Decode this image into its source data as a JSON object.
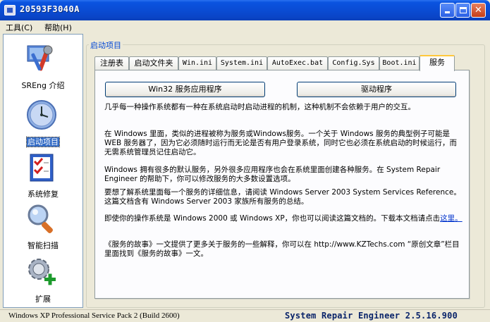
{
  "window": {
    "title": "20593F3040A"
  },
  "menubar": {
    "items": [
      {
        "label": "工具(C)"
      },
      {
        "label": "帮助(H)"
      }
    ]
  },
  "sidebar": {
    "items": [
      {
        "label": "SREng 介绍",
        "icon": "tools-icon",
        "selected": false
      },
      {
        "label": "启动项目",
        "icon": "clock-icon",
        "selected": true
      },
      {
        "label": "系统修复",
        "icon": "checklist-icon",
        "selected": false
      },
      {
        "label": "智能扫描",
        "icon": "magnifier-icon",
        "selected": false
      },
      {
        "label": "扩展",
        "icon": "gear-plus-icon",
        "selected": false
      }
    ]
  },
  "group": {
    "title": "启动项目"
  },
  "tabs": [
    {
      "label": "注册表"
    },
    {
      "label": "启动文件夹"
    },
    {
      "label": "Win.ini"
    },
    {
      "label": "System.ini"
    },
    {
      "label": "AutoExec.bat"
    },
    {
      "label": "Config.Sys"
    },
    {
      "label": "Boot.ini"
    },
    {
      "label": "服务",
      "active": true
    }
  ],
  "buttons": {
    "win32": "Win32 服务应用程序",
    "drivers": "驱动程序"
  },
  "content": {
    "p1": "几乎每一种操作系统都有一种在系统启动时启动进程的机制，这种机制不会依赖于用户的交互。",
    "p2": "在 Windows 里面，类似的进程被称为服务或Windows服务。一个关于 Windows 服务的典型例子可能是 WEB 服务器了，因为它必须随时运行而无论是否有用户登录系统，同时它也必须在系统启动的时候运行，而无需系统管理员记住启动它。",
    "p3": "Windows 拥有很多的默认服务，另外很多应用程序也会在系统里面创建各种服务。在 System Repair Engineer 的帮助下，你可以修改服务的大多数设置选项。",
    "p4": "要想了解系统里面每一个服务的详细信息，请阅读 Windows Server 2003 System Services Reference。这篇文档含有 Windows Server 2003 家族所有服务的总结。",
    "p5_text": "即使你的操作系统是 Windows 2000 或 Windows XP，你也可以阅读这篇文档的。下载本文档请点击",
    "p5_link": "这里。",
    "p6": "《服务的故事》一文提供了更多关于服务的一些解释，你可以在 http://www.KZTechs.com “原创文章”栏目里面找到《服务的故事》一文。"
  },
  "status": {
    "os": "Windows XP Professional Service Pack 2 (Build 2600)",
    "version": "System Repair Engineer 2.5.16.900"
  }
}
